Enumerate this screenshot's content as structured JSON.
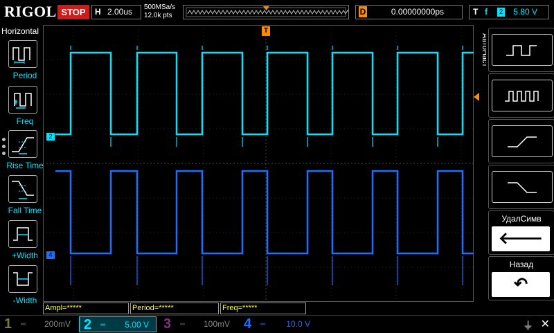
{
  "header": {
    "logo": "RIGOL",
    "run_state": "STOP",
    "h_label": "H",
    "timebase": "2.00us",
    "sample_rate": "500MSa/s",
    "mem_depth": "12.0k pts",
    "delay_label": "D",
    "delay_value": "0.00000000ps",
    "trigger_label": "T",
    "trigger_edge": "f",
    "trigger_channel": "2",
    "trigger_level": "5.80 V",
    "trigger_marker": "T"
  },
  "left_menu": {
    "title": "Horizontal",
    "items": [
      {
        "label": "Period",
        "icon": "period-icon"
      },
      {
        "label": "Freq",
        "icon": "freq-icon"
      },
      {
        "label": "Rise Time",
        "icon": "rise-time-icon"
      },
      {
        "label": "Fall Time",
        "icon": "fall-time-icon"
      },
      {
        "label": "+Width",
        "icon": "plus-width-icon"
      },
      {
        "label": "-Width",
        "icon": "minus-width-icon"
      }
    ]
  },
  "right_menu": {
    "title": "АвтоНаст",
    "buttons": [
      {
        "icon": "single-pulse-icon"
      },
      {
        "icon": "multi-pulse-icon"
      },
      {
        "icon": "rising-edge-icon"
      },
      {
        "icon": "falling-edge-icon"
      },
      {
        "label": "УдалСимв",
        "icon": "back-arrow-icon",
        "glyph": "🡐"
      },
      {
        "label": "Назад",
        "icon": "undo-icon",
        "glyph": "↶"
      }
    ]
  },
  "channel_markers": {
    "ch2": "2",
    "ch4": "4"
  },
  "measurements": {
    "ampl": "Ampl=*****",
    "period": "Period=*****",
    "freq": "Freq=*****"
  },
  "channels": [
    {
      "num": "1",
      "scale": "200mV",
      "color": "#7a7a30"
    },
    {
      "num": "2",
      "scale": "5.00 V",
      "color": "#00e5ff"
    },
    {
      "num": "3",
      "scale": "100mV",
      "color": "#8a2a8a"
    },
    {
      "num": "4",
      "scale": "10.0 V",
      "color": "#1e6fff"
    }
  ],
  "colors": {
    "ch2": "#00e5ff",
    "ch4": "#1e6fff",
    "trigger": "#ff8a00",
    "stop": "#d11b1b"
  }
}
